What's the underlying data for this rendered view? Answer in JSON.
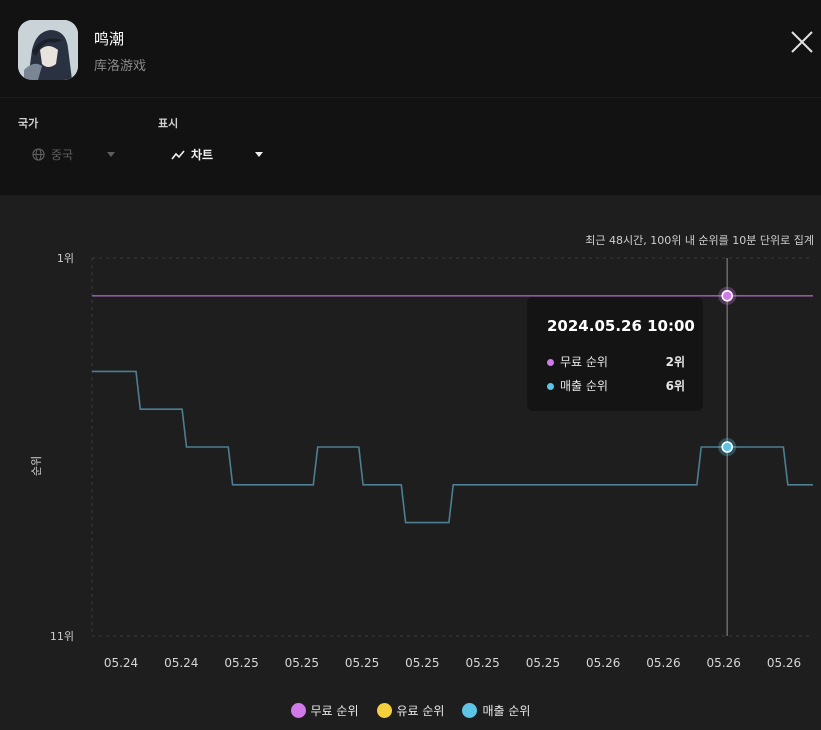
{
  "app": {
    "name": "鸣潮",
    "developer": "库洛游戏"
  },
  "filters": {
    "country": {
      "label": "국가",
      "value": "중국",
      "icon": "globe-icon"
    },
    "display": {
      "label": "표시",
      "value": "차트",
      "icon": "trend-icon"
    }
  },
  "note": "최근 48시간, 100위 내 순위를 10분 단위로 집계",
  "tooltip": {
    "title": "2024.05.26 10:00",
    "rows": [
      {
        "label": "무료 순위",
        "value": "2위",
        "color": "#d07ae9"
      },
      {
        "label": "매출 순위",
        "value": "6위",
        "color": "#5ec4e6"
      }
    ]
  },
  "legend": [
    {
      "label": "무료 순위",
      "color": "#d07ae9"
    },
    {
      "label": "유료 순위",
      "color": "#f4d03f"
    },
    {
      "label": "매출 순위",
      "color": "#5ec4e6"
    }
  ],
  "chart_data": {
    "type": "line",
    "ylabel": "순위",
    "y_ticks": [
      "1위",
      "11위"
    ],
    "ylim": [
      1,
      11
    ],
    "y_inverted": true,
    "x_ticks": [
      "05.24",
      "05.24",
      "05.25",
      "05.25",
      "05.25",
      "05.25",
      "05.25",
      "05.25",
      "05.26",
      "05.26",
      "05.26",
      "05.26"
    ],
    "step": true,
    "series": [
      {
        "name": "무료 순위",
        "color": "#d07ae9",
        "x": [
          0,
          1
        ],
        "y": [
          2,
          2
        ]
      },
      {
        "name": "매출 순위",
        "color": "#5ec4e6",
        "x": [
          0,
          0.061,
          0.067,
          0.125,
          0.131,
          0.189,
          0.195,
          0.307,
          0.313,
          0.37,
          0.376,
          0.429,
          0.435,
          0.495,
          0.501,
          0.839,
          0.845,
          0.959,
          0.965,
          1
        ],
        "y": [
          4,
          4,
          5,
          5,
          6,
          6,
          7,
          7,
          6,
          6,
          7,
          7,
          8,
          8,
          7,
          7,
          6,
          6,
          7,
          7
        ]
      }
    ],
    "highlight": {
      "x": 0.881,
      "points": [
        {
          "series": 0,
          "y": 2
        },
        {
          "series": 1,
          "y": 6
        }
      ]
    }
  }
}
